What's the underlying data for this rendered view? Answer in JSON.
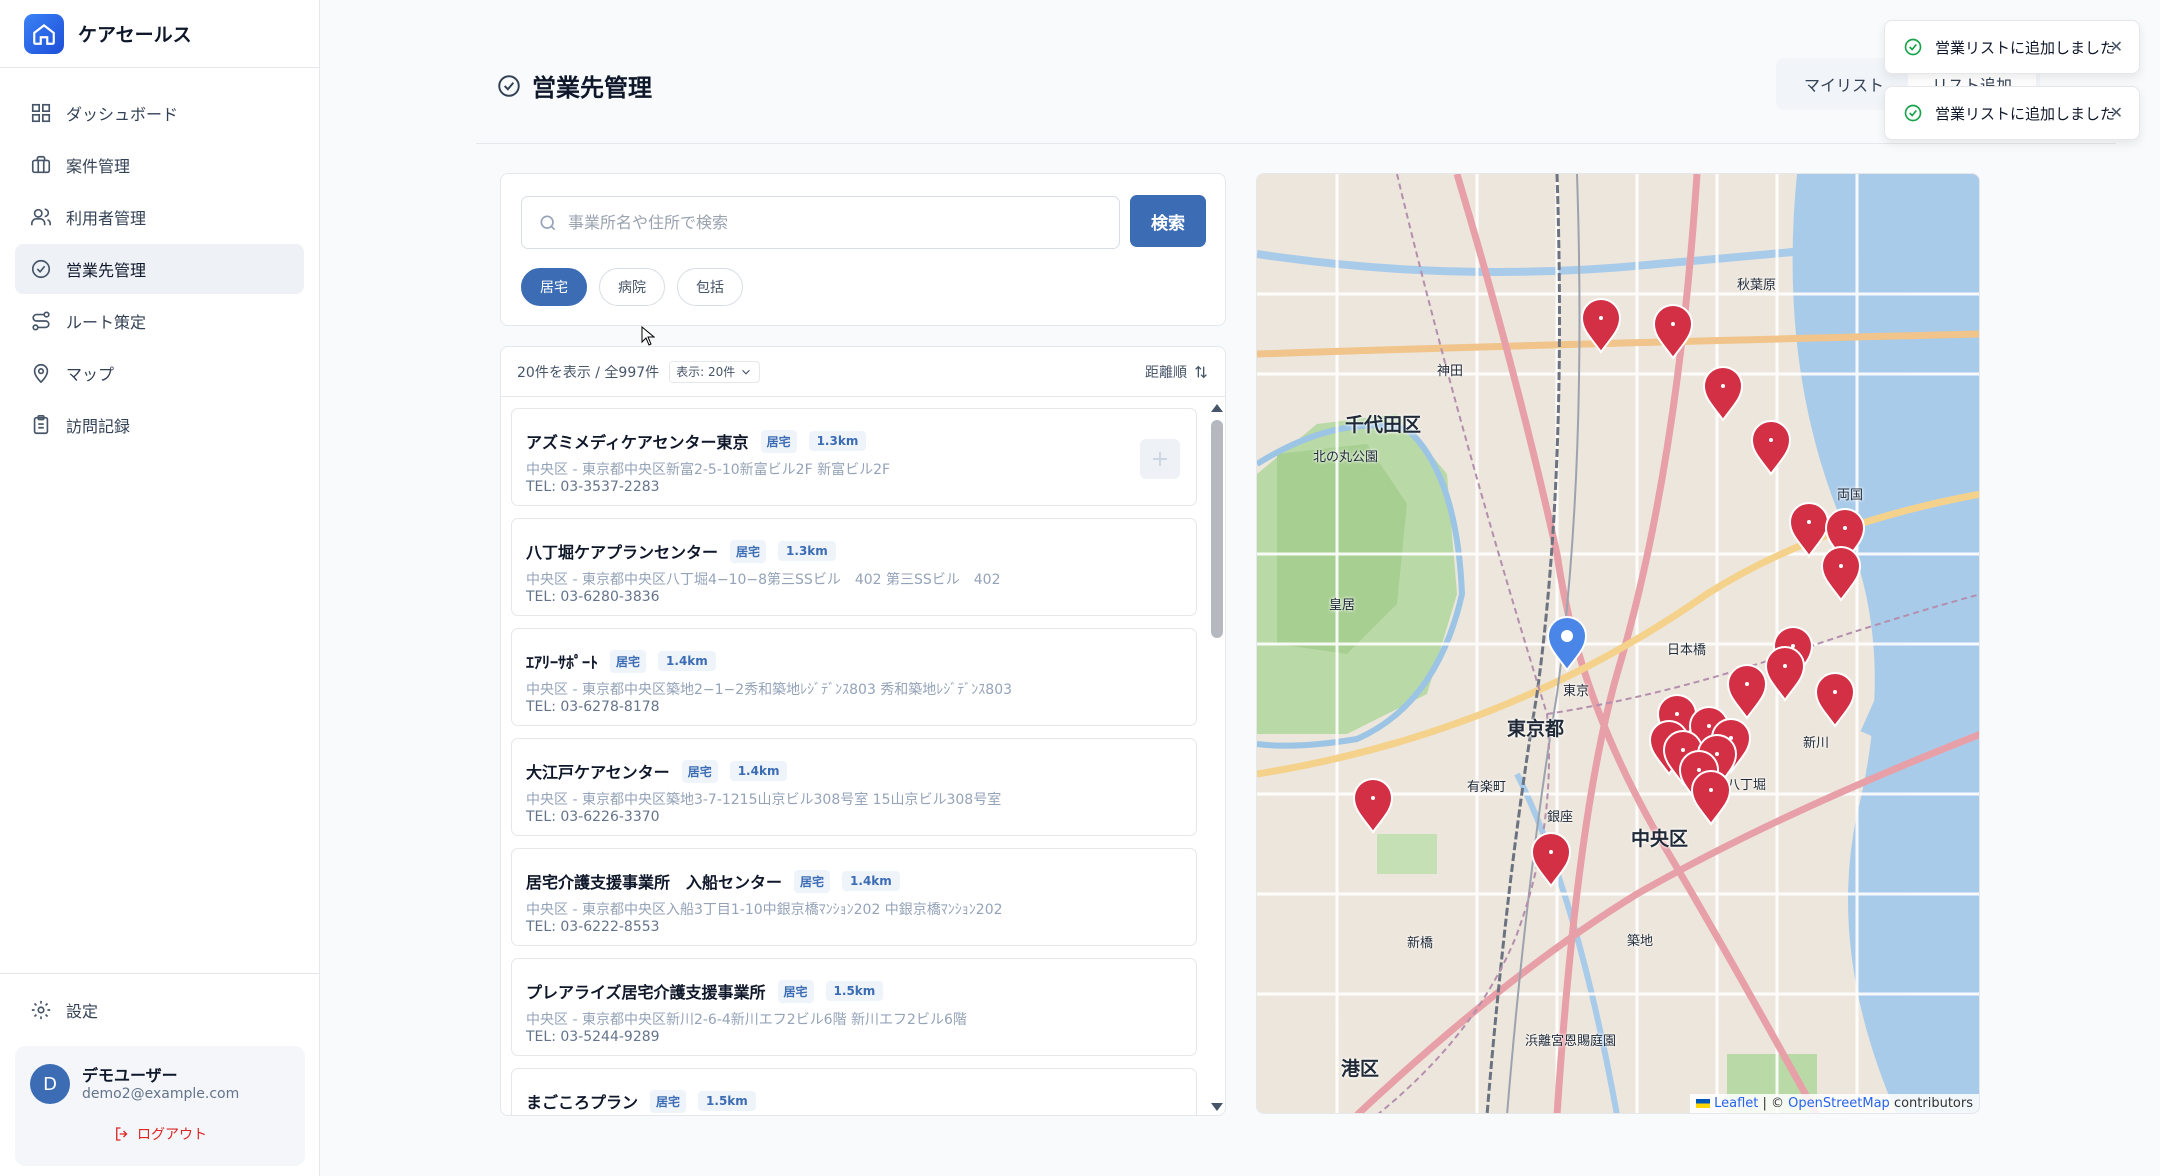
{
  "brand": {
    "name": "ケアセールス"
  },
  "nav": [
    {
      "label": "ダッシュボード",
      "icon": "dashboard-icon"
    },
    {
      "label": "案件管理",
      "icon": "briefcase-icon"
    },
    {
      "label": "利用者管理",
      "icon": "users-icon"
    },
    {
      "label": "営業先管理",
      "icon": "check-circle-icon",
      "active": true
    },
    {
      "label": "ルート策定",
      "icon": "route-icon"
    },
    {
      "label": "マップ",
      "icon": "map-pin-icon"
    },
    {
      "label": "訪問記録",
      "icon": "clipboard-icon"
    }
  ],
  "settings": {
    "label": "設定"
  },
  "user": {
    "initial": "D",
    "name": "デモユーザー",
    "email": "demo2@example.com",
    "logout": "ログアウト"
  },
  "header": {
    "title": "営業先管理",
    "tabs": [
      "マイリスト",
      "リスト追加"
    ]
  },
  "search": {
    "placeholder": "事業所名や住所で検索",
    "button": "検索",
    "value": ""
  },
  "filters": [
    {
      "label": "居宅",
      "active": true
    },
    {
      "label": "病院",
      "active": false
    },
    {
      "label": "包括",
      "active": false
    }
  ],
  "list_head": {
    "summary": "20件を表示 / 全997件",
    "per_page_label": "表示:",
    "per_page_value": "20件",
    "sort": "距離順"
  },
  "offices": [
    {
      "name": "アズミメディケアセンター東京",
      "tag": "居宅",
      "distance": "1.3km",
      "address": "中央区 - 東京都中央区新富2-5-10新富ビル2F 新富ビル2F",
      "tel": "TEL: 03-3537-2283"
    },
    {
      "name": "八丁堀ケアプランセンター",
      "tag": "居宅",
      "distance": "1.3km",
      "address": "中央区 - 東京都中央区八丁堀4−10−8第三SSビル　402 第三SSビル　402",
      "tel": "TEL: 03-6280-3836"
    },
    {
      "name": "ｴｱﾘｰｻﾎﾟｰﾄ",
      "tag": "居宅",
      "distance": "1.4km",
      "address": "中央区 - 東京都中央区築地2−1−2秀和築地ﾚｼﾞﾃﾞﾝｽ803 秀和築地ﾚｼﾞﾃﾞﾝｽ803",
      "tel": "TEL: 03-6278-8178"
    },
    {
      "name": "大江戸ケアセンター",
      "tag": "居宅",
      "distance": "1.4km",
      "address": "中央区 - 東京都中央区築地3-7-1215山京ビル308号室 15山京ビル308号室",
      "tel": "TEL: 03-6226-3370"
    },
    {
      "name": "居宅介護支援事業所　入船センター",
      "tag": "居宅",
      "distance": "1.4km",
      "address": "中央区 - 東京都中央区入船3丁目1-10中銀京橋ﾏﾝｼｮﾝ202 中銀京橋ﾏﾝｼｮﾝ202",
      "tel": "TEL: 03-6222-8553"
    },
    {
      "name": "プレアライズ居宅介護支援事業所",
      "tag": "居宅",
      "distance": "1.5km",
      "address": "中央区 - 東京都中央区新川2-6-4新川エフ2ビル6階 新川エフ2ビル6階",
      "tel": "TEL: 03-5244-9289"
    },
    {
      "name": "まごころプラン",
      "tag": "居宅",
      "distance": "1.5km",
      "address": "",
      "tel": ""
    }
  ],
  "map": {
    "labels": [
      "千代田区",
      "東京都",
      "中央区",
      "港区",
      "皇居",
      "東京",
      "日本橋",
      "銀座",
      "築地",
      "八丁堀",
      "新川",
      "浜離宮恩賜庭園",
      "神田",
      "秋葉原",
      "両国",
      "北の丸公園",
      "有楽町",
      "新橋"
    ],
    "attribution": {
      "leaflet": "Leaflet",
      "sep": " | © ",
      "osm": "OpenStreetMap",
      "suffix": " contributors"
    }
  },
  "toasts": [
    {
      "message": "営業リストに追加しました"
    },
    {
      "message": "営業リストに追加しました"
    }
  ],
  "colors": {
    "accent": "#3b6cb4",
    "marker_red": "#d32f45",
    "marker_blue": "#4a86e8",
    "success": "#16a34a"
  }
}
